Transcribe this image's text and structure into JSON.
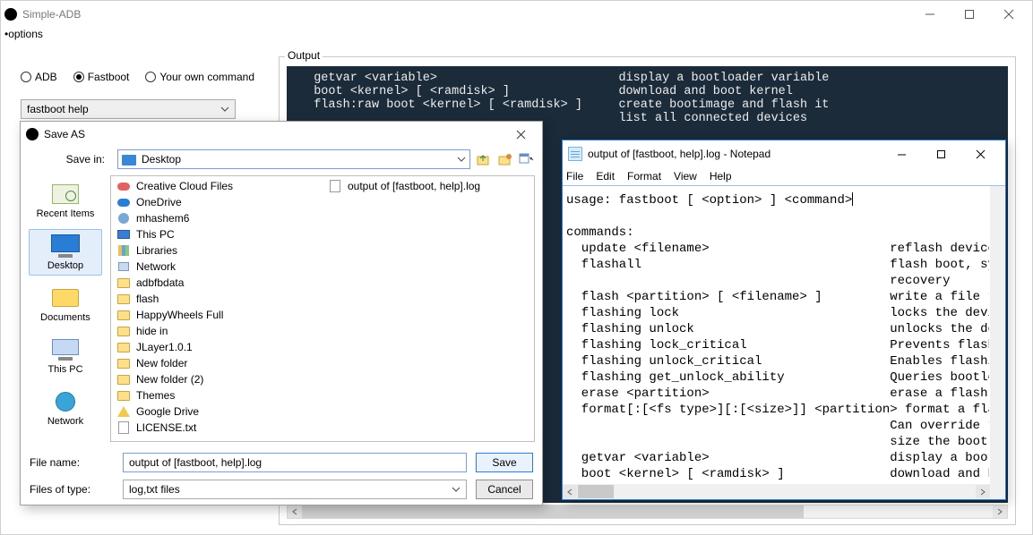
{
  "main": {
    "title": "Simple-ADB",
    "menu": {
      "options": "•options"
    },
    "radios": {
      "adb": "ADB",
      "fastboot": "Fastboot",
      "own": "Your own command",
      "selected": "fastboot"
    },
    "command_combo": "fastboot help",
    "output_legend": "Output",
    "output_text": "  getvar <variable>                         display a bootloader variable\n  boot <kernel> [ <ramdisk> ]               download and boot kernel\n  flash:raw boot <kernel> [ <ramdisk> ]     create bootimage and flash it\n                                            list all connected devices"
  },
  "saveas": {
    "title": "Save AS",
    "savein_lbl": "Save in:",
    "savein_val": "Desktop",
    "places": {
      "recent": "Recent Items",
      "desktop": "Desktop",
      "documents": "Documents",
      "thispc": "This PC",
      "network": "Network"
    },
    "files_col1": [
      {
        "icon": "cloud",
        "name": "Creative Cloud Files"
      },
      {
        "icon": "onedrive",
        "name": "OneDrive"
      },
      {
        "icon": "user",
        "name": "mhashem6"
      },
      {
        "icon": "thispc",
        "name": "This PC"
      },
      {
        "icon": "lib",
        "name": "Libraries"
      },
      {
        "icon": "network",
        "name": "Network"
      },
      {
        "icon": "folder",
        "name": "adbfbdata"
      },
      {
        "icon": "folder",
        "name": "flash"
      },
      {
        "icon": "folder",
        "name": "HappyWheels Full"
      },
      {
        "icon": "folder",
        "name": "hide in"
      },
      {
        "icon": "folder",
        "name": "JLayer1.0.1"
      },
      {
        "icon": "folder",
        "name": "New folder"
      },
      {
        "icon": "folder",
        "name": "New folder (2)"
      },
      {
        "icon": "folder",
        "name": "Themes"
      },
      {
        "icon": "gdrive",
        "name": "Google Drive"
      },
      {
        "icon": "txt",
        "name": "LICENSE.txt"
      }
    ],
    "files_col2": [
      {
        "icon": "txt",
        "name": "output of [fastboot, help].log"
      }
    ],
    "filename_lbl": "File name:",
    "filename_val": "output of [fastboot, help].log",
    "filetype_lbl": "Files of type:",
    "filetype_val": "log,txt files",
    "save_btn": "Save",
    "cancel_btn": "Cancel"
  },
  "notepad": {
    "title": "output of [fastboot, help].log - Notepad",
    "menu": {
      "file": "File",
      "edit": "Edit",
      "format": "Format",
      "view": "View",
      "help": "Help"
    },
    "line1": "usage: fastboot [ <option> ] <command>",
    "body_rest": "commands:\n  update <filename>                        reflash device f\n  flashall                                 flash boot, syst\n                                           recovery\n  flash <partition> [ <filename> ]         write a file to \n  flashing lock                            locks the device\n  flashing unlock                          unlocks the devi\n  flashing lock_critical                   Prevents flashin\n  flashing unlock_critical                 Enables flashing\n  flashing get_unlock_ability              Queries bootload\n  erase <partition>                        erase a flash pa\n  format[:[<fs type>][:[<size>]] <partition> format a flash\n                                           Can override the\n                                           size the bootloa\n  getvar <variable>                        display a bootlo\n  boot <kernel> [ <ramdisk> ]              download and boo"
  }
}
